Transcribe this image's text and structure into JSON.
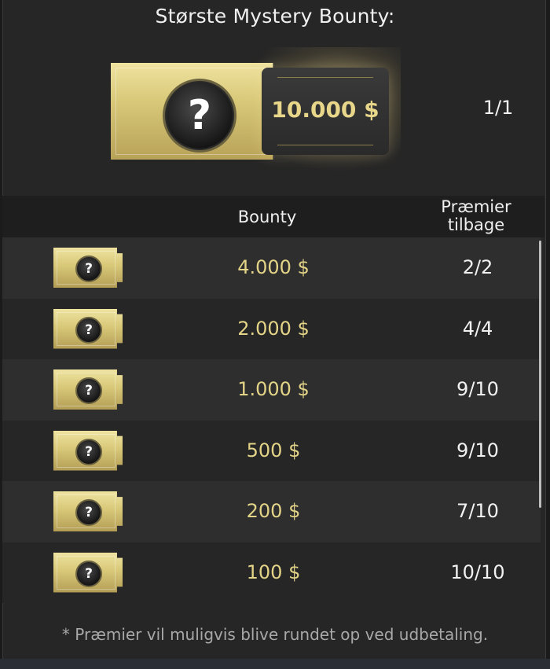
{
  "title": "Største Mystery Bounty:",
  "top_prize": {
    "amount": "10.000 $",
    "remaining": "1/1",
    "icon": "question-mark-icon"
  },
  "table": {
    "headers": {
      "bounty": "Bounty",
      "prizes_left": "Præmier tilbage"
    },
    "rows": [
      {
        "amount": "4.000 $",
        "remaining": "2/2",
        "icon": "question-mark-icon"
      },
      {
        "amount": "2.000 $",
        "remaining": "4/4",
        "icon": "question-mark-icon"
      },
      {
        "amount": "1.000 $",
        "remaining": "9/10",
        "icon": "question-mark-icon"
      },
      {
        "amount": "500 $",
        "remaining": "9/10",
        "icon": "question-mark-icon"
      },
      {
        "amount": "200 $",
        "remaining": "7/10",
        "icon": "question-mark-icon"
      },
      {
        "amount": "100 $",
        "remaining": "10/10",
        "icon": "question-mark-icon"
      }
    ]
  },
  "footnote": "* Præmier vil muligvis blive rundet op ved udbetaling.",
  "colors": {
    "accent_gold": "#e3d487",
    "background": "#262626"
  }
}
